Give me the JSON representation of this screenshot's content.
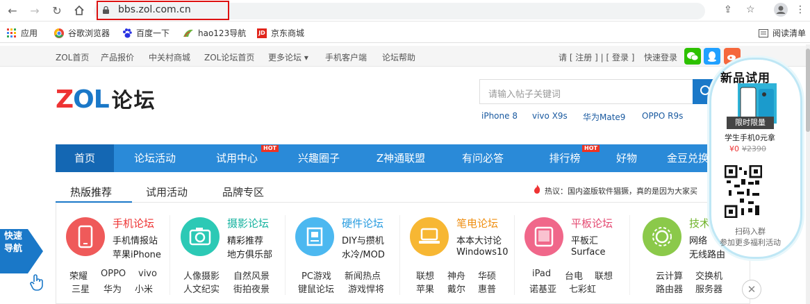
{
  "browser": {
    "url": "bbs.zol.com.cn",
    "bookmarks": [
      {
        "label": "应用",
        "icon": "apps-grid-icon"
      },
      {
        "label": "谷歌浏览器",
        "icon": "chrome-icon"
      },
      {
        "label": "百度一下",
        "icon": "baidu-paw-icon"
      },
      {
        "label": "hao123导航",
        "icon": "hao123-icon"
      },
      {
        "label": "京东商城",
        "icon": "jd-icon"
      }
    ],
    "reading_list": "阅读清单"
  },
  "topbar": {
    "links": [
      "ZOL首页",
      "产品报价",
      "中关村商城",
      "ZOL论坛首页",
      "更多论坛 ▾",
      "手机客户端",
      "论坛帮助"
    ],
    "account": "请 [ 注册 ] | [ 登录 ]",
    "quick_login": "快速登录"
  },
  "header": {
    "logo_z": "Z",
    "logo_o": "O",
    "logo_l": "L",
    "logo_text": "论坛",
    "search_placeholder": "请输入帖子关键词",
    "hot_keywords": [
      "iPhone 8",
      "vivo X9s",
      "华为Mate9",
      "OPPO R9s"
    ]
  },
  "nav": {
    "items": [
      "首页",
      "论坛活动",
      "试用中心",
      "兴趣圈子",
      "Z神通联盟",
      "有问必答",
      "排行榜",
      "好物",
      "金豆兑换"
    ],
    "hot_badge": "HOT"
  },
  "tabs": [
    "热版推荐",
    "试用活动",
    "品牌专区"
  ],
  "hot_notice": "热议：国内盗版软件猖獗，真的是因为大家买",
  "categories": [
    {
      "title": "手机论坛",
      "desc1": "手机情报站",
      "desc2": "苹果iPhone",
      "links1": [
        "荣耀",
        "OPPO",
        "vivo"
      ],
      "links2": [
        "三星",
        "华为",
        "小米"
      ],
      "color": "#ef5a5a",
      "title_color": "#e33"
    },
    {
      "title": "摄影论坛",
      "desc1": "精彩推荐",
      "desc2": "地方俱乐部",
      "links1": [
        "人像摄影",
        "自然风景"
      ],
      "links2": [
        "人文纪实",
        "街拍夜景"
      ],
      "color": "#2cc9b5",
      "title_color": "#17b3a0"
    },
    {
      "title": "硬件论坛",
      "desc1": "DIY与攒机",
      "desc2": "水冷/MOD",
      "links1": [
        "PC游戏",
        "新闻热点"
      ],
      "links2": [
        "键鼠论坛",
        "游戏悍将"
      ],
      "color": "#4cb8f0",
      "title_color": "#2a9de0"
    },
    {
      "title": "笔电论坛",
      "desc1": "本本大讨论",
      "desc2": "Windows10",
      "links1": [
        "联想",
        "神舟",
        "华硕"
      ],
      "links2": [
        "苹果",
        "戴尔",
        "惠普"
      ],
      "color": "#f7b733",
      "title_color": "#ef8f12"
    },
    {
      "title": "平板论坛",
      "desc1": "平板汇",
      "desc2": "Surface",
      "links1": [
        "iPad",
        "台电",
        "联想"
      ],
      "links2": [
        "诺基亚",
        "七彩虹"
      ],
      "color": "#f0678a",
      "title_color": "#e44a72"
    },
    {
      "title": "技术",
      "desc1": "网络",
      "desc2": "无线路由",
      "links1": [
        "云计算",
        "交换机"
      ],
      "links2": [
        "路由器",
        "服务器"
      ],
      "color": "#8bc94a",
      "title_color": "#6fb32a"
    }
  ],
  "quicknav": "快速导航",
  "float": {
    "title": "新品试用",
    "limit": "限时限量",
    "sub": "学生手机0元拿",
    "price": "¥0",
    "orig_price": "¥2390",
    "scan": "扫码入群",
    "more": "参加更多福利活动"
  }
}
